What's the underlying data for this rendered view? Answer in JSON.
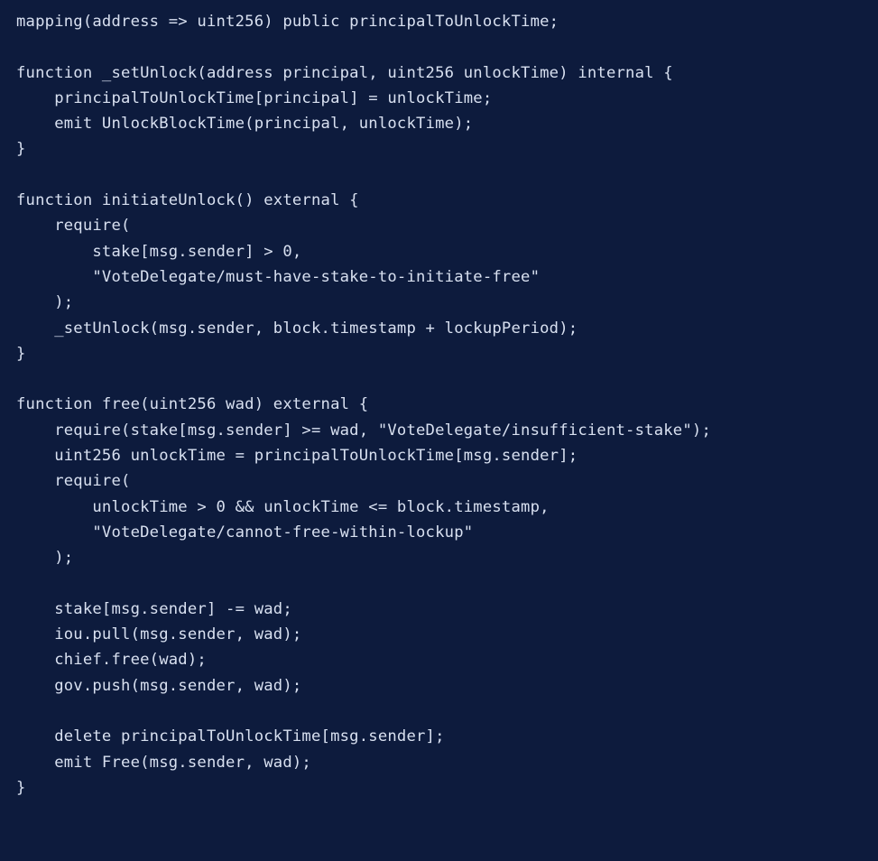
{
  "code": {
    "lines": [
      "mapping(address => uint256) public principalToUnlockTime;",
      "",
      "function _setUnlock(address principal, uint256 unlockTime) internal {",
      "    principalToUnlockTime[principal] = unlockTime;",
      "    emit UnlockBlockTime(principal, unlockTime);",
      "}",
      "",
      "function initiateUnlock() external {",
      "    require(",
      "        stake[msg.sender] > 0,",
      "        \"VoteDelegate/must-have-stake-to-initiate-free\"",
      "    );",
      "    _setUnlock(msg.sender, block.timestamp + lockupPeriod);",
      "}",
      "",
      "function free(uint256 wad) external {",
      "    require(stake[msg.sender] >= wad, \"VoteDelegate/insufficient-stake\");",
      "    uint256 unlockTime = principalToUnlockTime[msg.sender];",
      "    require(",
      "        unlockTime > 0 && unlockTime <= block.timestamp,",
      "        \"VoteDelegate/cannot-free-within-lockup\"",
      "    );",
      "",
      "    stake[msg.sender] -= wad;",
      "    iou.pull(msg.sender, wad);",
      "    chief.free(wad);",
      "    gov.push(msg.sender, wad);",
      "",
      "    delete principalToUnlockTime[msg.sender];",
      "    emit Free(msg.sender, wad);",
      "}"
    ]
  }
}
